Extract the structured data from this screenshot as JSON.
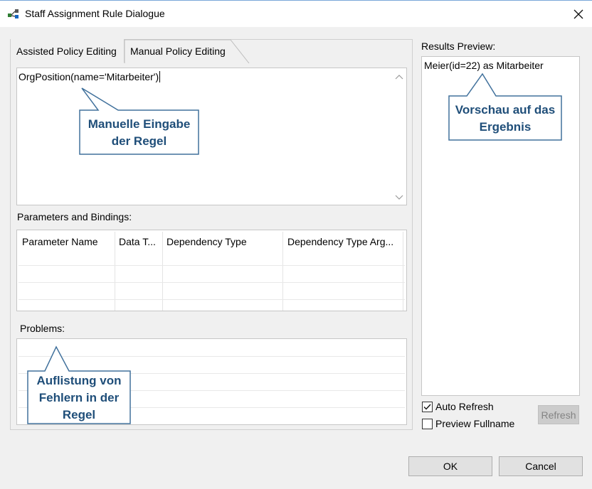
{
  "window": {
    "title": "Staff Assignment Rule Dialogue",
    "close_glyph": "✕"
  },
  "tabs": [
    {
      "label": "Assisted Policy Editing",
      "selected": false
    },
    {
      "label": "Manual Policy Editing",
      "selected": true
    }
  ],
  "editor": {
    "text": "OrgPosition(name='Mitarbeiter')"
  },
  "parameters": {
    "label": "Parameters and Bindings:",
    "columns": [
      "Parameter Name",
      "Data T...",
      "Dependency Type",
      "Dependency Type Arg..."
    ]
  },
  "problems": {
    "label": "Problems:"
  },
  "results": {
    "label": "Results Preview:",
    "items": [
      "Meier(id=22) as Mitarbeiter"
    ]
  },
  "options": {
    "auto_refresh": {
      "label": "Auto Refresh",
      "checked": true
    },
    "preview_fullname": {
      "label": "Preview Fullname",
      "checked": false
    }
  },
  "buttons": {
    "refresh": "Refresh",
    "ok": "OK",
    "cancel": "Cancel"
  },
  "callouts": {
    "editor": [
      "Manuelle Eingabe",
      "der Regel"
    ],
    "results": [
      "Vorschau auf das",
      "Ergebnis"
    ],
    "problems": [
      "Auflistung von",
      "Fehlern in der",
      "Regel"
    ]
  },
  "icons": {
    "app": "workflow-nodes-icon",
    "close": "close-icon",
    "scroll_up": "scroll-up-arrow-icon",
    "scroll_down": "scroll-down-arrow-icon",
    "check": "checkmark-icon"
  },
  "colors": {
    "callout_border": "#41719c",
    "callout_text": "#1f4e79",
    "dialog_bg": "#f0f0f0",
    "titlebar_accent": "#7aa7d8"
  }
}
